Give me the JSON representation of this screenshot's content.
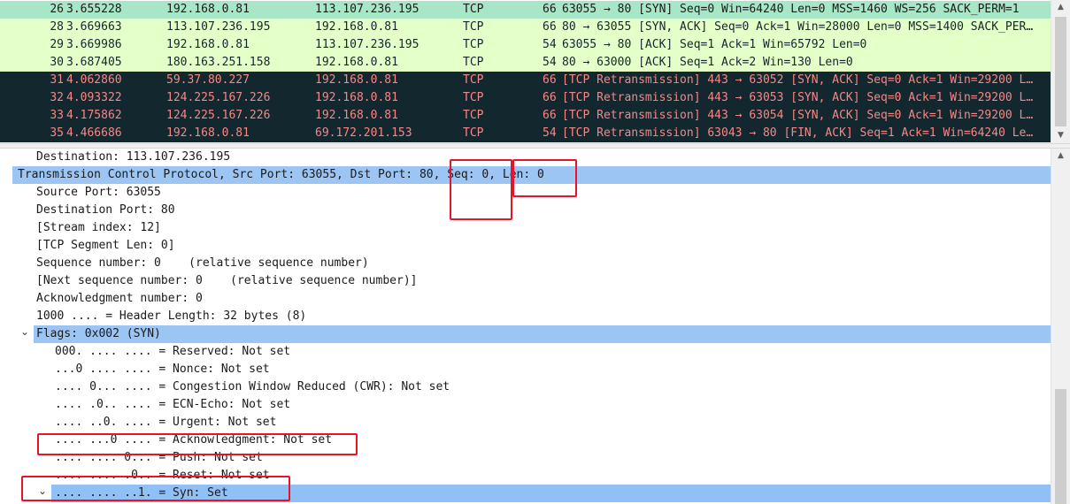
{
  "packet_list": {
    "rows": [
      {
        "no": "26",
        "time": "3.655228",
        "src": "192.168.0.81",
        "dst": "113.107.236.195",
        "proto": "TCP",
        "len": "66",
        "info": "63055 → 80 [SYN] Seq=0 Win=64240 Len=0 MSS=1460 WS=256 SACK_PERM=1"
      },
      {
        "no": "28",
        "time": "3.669663",
        "src": "113.107.236.195",
        "dst": "192.168.0.81",
        "proto": "TCP",
        "len": "66",
        "info": "80 → 63055 [SYN, ACK] Seq=0 Ack=1 Win=28000 Len=0 MSS=1400 SACK_PER…"
      },
      {
        "no": "29",
        "time": "3.669986",
        "src": "192.168.0.81",
        "dst": "113.107.236.195",
        "proto": "TCP",
        "len": "54",
        "info": "63055 → 80 [ACK] Seq=1 Ack=1 Win=65792 Len=0"
      },
      {
        "no": "30",
        "time": "3.687405",
        "src": "180.163.251.158",
        "dst": "192.168.0.81",
        "proto": "TCP",
        "len": "54",
        "info": "80 → 63000 [ACK] Seq=1 Ack=2 Win=130 Len=0"
      },
      {
        "no": "31",
        "time": "4.062860",
        "src": "59.37.80.227",
        "dst": "192.168.0.81",
        "proto": "TCP",
        "len": "66",
        "info": "[TCP Retransmission] 443 → 63052 [SYN, ACK] Seq=0 Ack=1 Win=29200 L…"
      },
      {
        "no": "32",
        "time": "4.093322",
        "src": "124.225.167.226",
        "dst": "192.168.0.81",
        "proto": "TCP",
        "len": "66",
        "info": "[TCP Retransmission] 443 → 63053 [SYN, ACK] Seq=0 Ack=1 Win=29200 L…"
      },
      {
        "no": "33",
        "time": "4.175862",
        "src": "124.225.167.226",
        "dst": "192.168.0.81",
        "proto": "TCP",
        "len": "66",
        "info": "[TCP Retransmission] 443 → 63054 [SYN, ACK] Seq=0 Ack=1 Win=29200 L…"
      },
      {
        "no": "35",
        "time": "4.466686",
        "src": "192.168.0.81",
        "dst": "69.172.201.153",
        "proto": "TCP",
        "len": "54",
        "info": "[TCP Retransmission] 63043 → 80 [FIN, ACK] Seq=1 Ack=1 Win=64240 Le…"
      }
    ]
  },
  "details": {
    "lines": [
      {
        "text": "Destination: 113.107.236.195"
      },
      {
        "text": "Transmission Control Protocol, Src Port: 63055, Dst Port: 80, Seq: 0, Len: 0"
      },
      {
        "text": "Source Port: 63055"
      },
      {
        "text": "Destination Port: 80"
      },
      {
        "text": "[Stream index: 12]"
      },
      {
        "text": "[TCP Segment Len: 0]"
      },
      {
        "text": "Sequence number: 0    (relative sequence number)"
      },
      {
        "text": "[Next sequence number: 0    (relative sequence number)]"
      },
      {
        "text": "Acknowledgment number: 0"
      },
      {
        "text": "1000 .... = Header Length: 32 bytes (8)"
      },
      {
        "text": "Flags: 0x002 (SYN)"
      },
      {
        "text": "000. .... .... = Reserved: Not set"
      },
      {
        "text": "...0 .... .... = Nonce: Not set"
      },
      {
        "text": ".... 0... .... = Congestion Window Reduced (CWR): Not set"
      },
      {
        "text": ".... .0.. .... = ECN-Echo: Not set"
      },
      {
        "text": ".... ..0. .... = Urgent: Not set"
      },
      {
        "text": ".... ...0 .... = Acknowledgment: Not set"
      },
      {
        "text": ".... .... 0... = Push: Not set"
      },
      {
        "text": ".... .... .0.. = Reset: Not set"
      },
      {
        "text": ".... .... ..1. = Syn: Set"
      }
    ]
  },
  "icons": {
    "expanded_caret": "chevron-down-icon",
    "scroll_up": "arrow-up-icon",
    "scroll_down": "arrow-down-icon"
  },
  "colors": {
    "row_green": "#e4ffc7",
    "row_selected_first": "#a8e6c8",
    "row_dark_bg": "#12272e",
    "row_dark_text": "#f78787",
    "selection_blue": "#9cc5f4",
    "annotation_red": "#e8132a"
  }
}
